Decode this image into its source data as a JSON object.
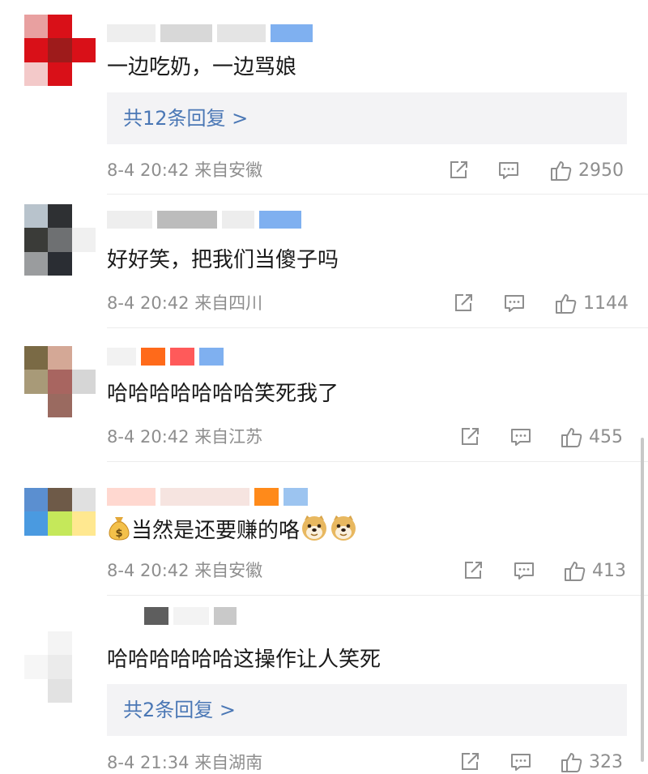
{
  "comments": [
    {
      "text": "一边吃奶，一边骂娘",
      "replies_label": "共12条回复 >",
      "date": "8-4 20:42",
      "location": "来自安徽",
      "likes": "2950"
    },
    {
      "text": "好好笑，把我们当傻子吗",
      "date": "8-4 20:42",
      "location": "来自四川",
      "likes": "1144"
    },
    {
      "text": "哈哈哈哈哈哈哈笑死我了",
      "date": "8-4 20:42",
      "location": "来自江苏",
      "likes": "455"
    },
    {
      "text": "当然是还要赚的咯",
      "date": "8-4 20:42",
      "location": "来自安徽",
      "likes": "413"
    },
    {
      "text": "哈哈哈哈哈哈这操作让人笑死",
      "replies_label": "共2条回复 >",
      "date": "8-4 21:34",
      "location": "来自湖南",
      "likes": "323"
    }
  ],
  "icons": {
    "share": "share-icon",
    "comment": "comment-icon",
    "like": "thumbs-up-icon",
    "money": "money-bag-icon",
    "doge": "doge-icon"
  },
  "colors": {
    "reply_link": "#4a77b5",
    "meta_text": "#8e8e8e",
    "reply_box": "#f3f3f5"
  }
}
